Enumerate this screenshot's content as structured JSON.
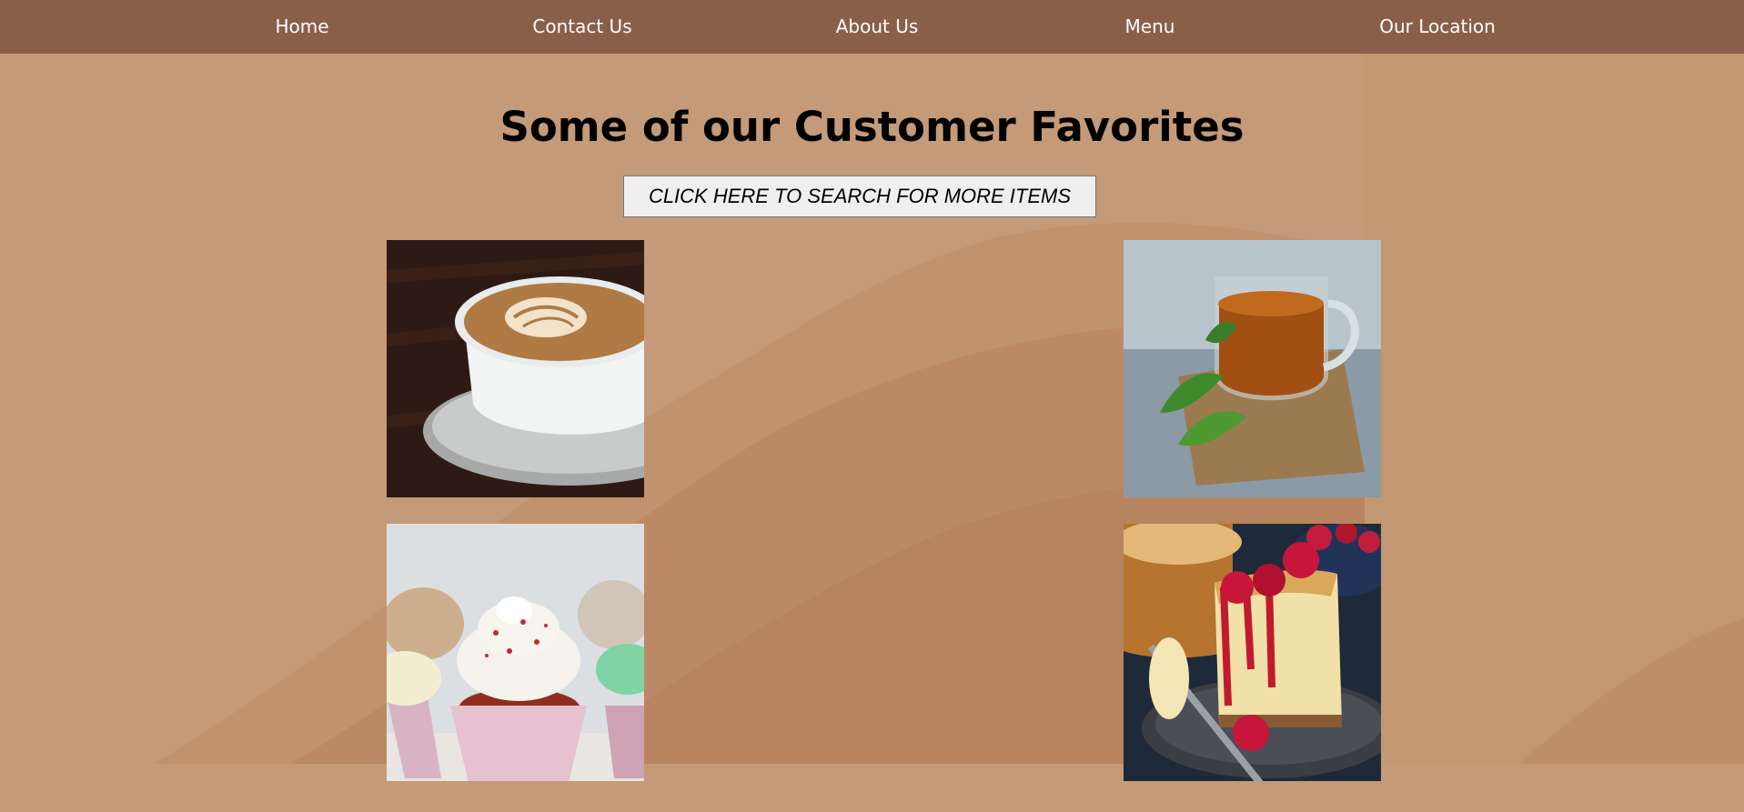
{
  "nav": {
    "items": [
      {
        "label": "Home"
      },
      {
        "label": "Contact Us"
      },
      {
        "label": "About Us"
      },
      {
        "label": "Menu"
      },
      {
        "label": "Our Location"
      }
    ]
  },
  "main": {
    "title": "Some of our Customer Favorites",
    "search_button": "CLICK HERE TO SEARCH FOR MORE ITEMS"
  },
  "favorites": [
    {
      "icon": "latte-icon"
    },
    {
      "icon": "tea-cup-icon"
    },
    {
      "icon": "cupcake-icon"
    },
    {
      "icon": "cheesecake-icon"
    }
  ],
  "colors": {
    "nav_bg": "#8a5f49",
    "page_bg": "#c49a78",
    "nav_text": "#ffffff"
  }
}
